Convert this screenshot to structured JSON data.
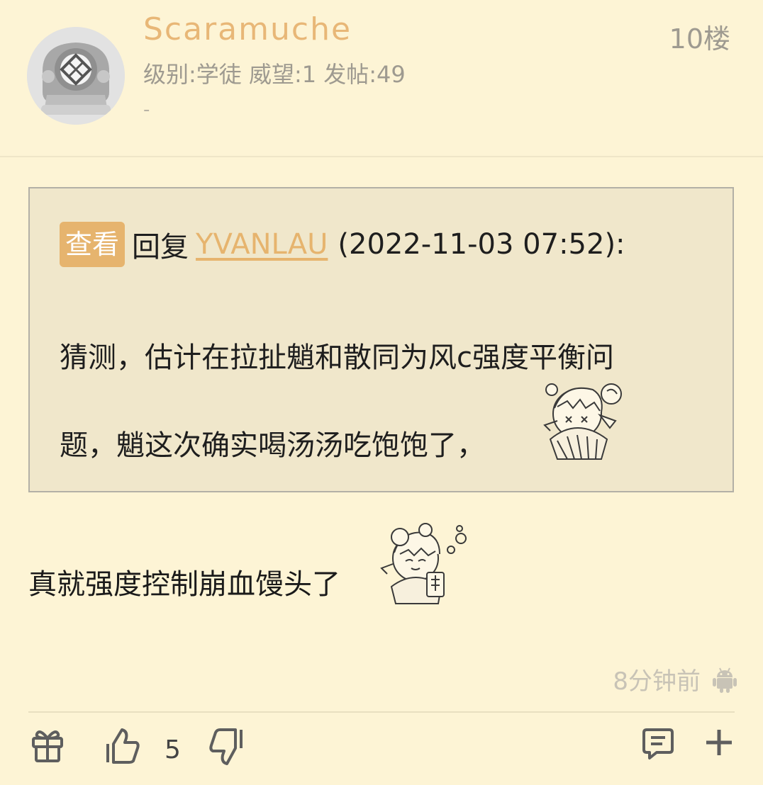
{
  "user": {
    "name": "Scaramuche",
    "info": "级别:学徒 威望:1 发帖:49",
    "signature": "-"
  },
  "floor": "10楼",
  "quote": {
    "view_label": "查看",
    "reply_prefix": "回复",
    "reply_user": "YVANLAU",
    "reply_time": "(2022-11-03 07:52):",
    "line1": "猜测，估计在拉扯魈和散同为风c强度平衡问",
    "line2": "题，魈这次确实喝汤汤吃饱饱了，"
  },
  "post": {
    "text": "真就强度控制崩血馒头了"
  },
  "meta": {
    "time": "8分钟前",
    "device_icon": "android-icon"
  },
  "actions": {
    "like_count": "5"
  },
  "colors": {
    "background": "#fdf4d5",
    "accent": "#e6b46e",
    "quote_background": "#f0e7cb",
    "muted": "#9e9a90"
  }
}
